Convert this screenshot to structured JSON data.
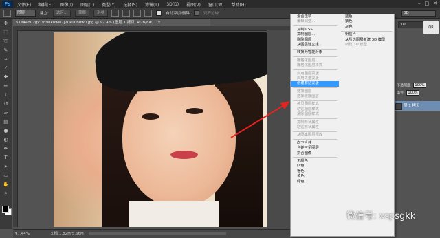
{
  "app": {
    "logo": "Ps"
  },
  "menu": [
    "文件(F)",
    "编辑(E)",
    "图像(I)",
    "图层(L)",
    "类型(Y)",
    "选择(S)",
    "滤镜(T)",
    "3D(D)",
    "视图(V)",
    "窗口(W)",
    "帮助(H)"
  ],
  "window_controls": [
    "–",
    "□",
    "✕"
  ],
  "options": {
    "tool_select": "图层",
    "align_label": "建立:",
    "btn_selection": "选区...",
    "btn_mask": "蒙版",
    "btn_shape": "形状",
    "auto_add_delete": "自动添加/删除",
    "align_edges": "对齐边缘",
    "workspace": "3D"
  },
  "document": {
    "tab": "61e44d02gy1fn98k8ww7j20ku0n0wu.jpg @ 97.4% (图层 1 拷贝, RGB/8#)",
    "close": "×",
    "zoom": "97.44%",
    "doc_size": "文档:1.82M/5.66M"
  },
  "tools": [
    "move",
    "marquee",
    "lasso",
    "quick-select",
    "crop",
    "eyedropper",
    "healing",
    "brush",
    "clone-stamp",
    "history-brush",
    "eraser",
    "gradient",
    "blur",
    "dodge",
    "pen",
    "type",
    "path-select",
    "shape",
    "hand",
    "zoom"
  ],
  "context_menu": {
    "left": [
      {
        "label": "混合选项...",
        "enabled": true
      },
      {
        "label": "编辑调整...",
        "enabled": false
      },
      {
        "sep": true
      },
      {
        "label": "复制 CSS",
        "enabled": true
      },
      {
        "label": "复制图层...",
        "enabled": true
      },
      {
        "label": "删除图层",
        "enabled": true
      },
      {
        "label": "从图层建立组...",
        "enabled": true
      },
      {
        "sep": true
      },
      {
        "label": "转换为智能对象",
        "enabled": true
      },
      {
        "sep": true
      },
      {
        "label": "栅格化图层",
        "enabled": false
      },
      {
        "label": "栅格化图层样式",
        "enabled": false
      },
      {
        "sep": true
      },
      {
        "label": "启用图层蒙版",
        "enabled": false
      },
      {
        "label": "启用矢量蒙版",
        "enabled": false
      },
      {
        "label": "创建剪贴蒙版",
        "enabled": true,
        "highlight": true
      },
      {
        "sep": true
      },
      {
        "label": "链接图层",
        "enabled": false
      },
      {
        "label": "选择链接图层",
        "enabled": false
      },
      {
        "sep": true
      },
      {
        "label": "拷贝图层样式",
        "enabled": false
      },
      {
        "label": "粘贴图层样式",
        "enabled": false
      },
      {
        "label": "清除图层样式",
        "enabled": false
      },
      {
        "sep": true
      },
      {
        "label": "复制形状属性",
        "enabled": false
      },
      {
        "label": "粘贴形状属性",
        "enabled": false
      },
      {
        "sep": true
      },
      {
        "label": "从隔离图层释放",
        "enabled": false
      },
      {
        "sep": true
      },
      {
        "label": "向下合并",
        "enabled": true
      },
      {
        "label": "合并可见图层",
        "enabled": true
      },
      {
        "label": "拼合图像",
        "enabled": true
      },
      {
        "sep": true
      },
      {
        "label": "无颜色",
        "enabled": true
      },
      {
        "label": "红色",
        "enabled": true
      },
      {
        "label": "橙色",
        "enabled": true
      },
      {
        "label": "黄色",
        "enabled": true
      },
      {
        "label": "绿色",
        "enabled": true
      }
    ],
    "right": [
      {
        "label": "蓝色",
        "enabled": true
      },
      {
        "label": "紫色",
        "enabled": true
      },
      {
        "label": "灰色",
        "enabled": true
      },
      {
        "sep": true
      },
      {
        "label": "明信片",
        "enabled": true
      },
      {
        "label": "从所选图层新建 3D 模型",
        "enabled": true
      },
      {
        "label": "新建 3D 模型",
        "enabled": false
      }
    ]
  },
  "layers_panel": {
    "row_opacity_label": "不透明度:",
    "row_opacity": "100%",
    "row_fill_label": "填充:",
    "row_fill": "100%",
    "layer_name": "层 1 拷贝",
    "qr_text": "QR"
  },
  "watermark": "微信号: xspsgkk"
}
